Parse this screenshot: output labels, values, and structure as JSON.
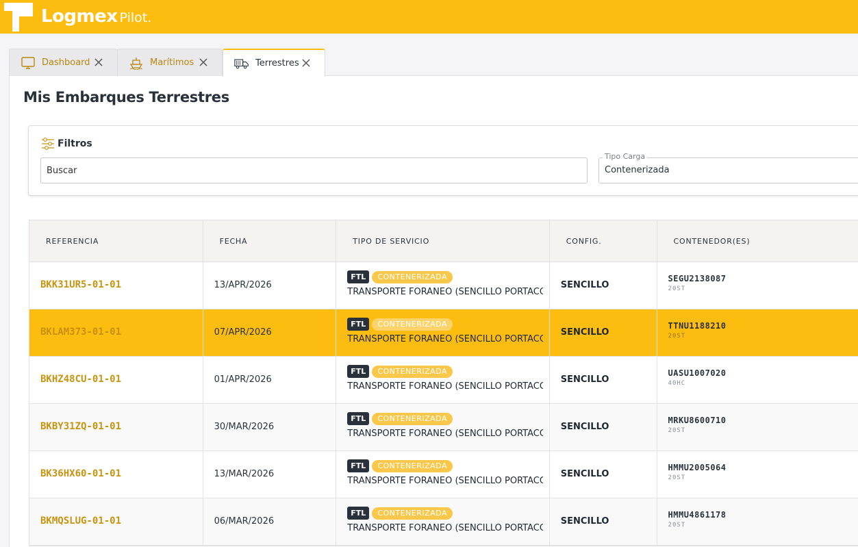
{
  "app": {
    "brand": "Logmex",
    "product": "Pilot.",
    "accent_color": "#fdbd10"
  },
  "tabs": [
    {
      "label": "Dashboard",
      "icon": "monitor-icon",
      "active": false
    },
    {
      "label": "Marítimos",
      "icon": "ship-icon",
      "active": false
    },
    {
      "label": "Terrestres",
      "icon": "truck-icon",
      "active": true
    }
  ],
  "page": {
    "title": "Mis Embarques Terrestres"
  },
  "filters": {
    "title": "Filtros",
    "search_placeholder": "Buscar",
    "tipo_carga_label": "Tipo Carga",
    "tipo_carga_value": "Contenerizada"
  },
  "table": {
    "columns": [
      "REFERENCIA",
      "FECHA",
      "TIPO DE SERVICIO",
      "CONFIG.",
      "CONTENEDOR(ES)"
    ],
    "rows": [
      {
        "ref": "BKK31UR5-01-01",
        "fecha": "13/APR/2026",
        "modo": "FTL",
        "tipo": "CONTENERIZADA",
        "servicio": "TRANSPORTE FORÁNEO (SENCILLO PORTACONTI",
        "config": "SENCILLO",
        "contenedor": "SEGU2138087",
        "tamano": "20ST"
      },
      {
        "ref": "BKLAM373-01-01",
        "fecha": "07/APR/2026",
        "modo": "FTL",
        "tipo": "CONTENERIZADA",
        "servicio": "TRANSPORTE FORÁNEO (SENCILLO PORTACONTI",
        "config": "SENCILLO",
        "contenedor": "TTNU1188210",
        "tamano": "20ST"
      },
      {
        "ref": "BKHZ48CU-01-01",
        "fecha": "01/APR/2026",
        "modo": "FTL",
        "tipo": "CONTENERIZADA",
        "servicio": "TRANSPORTE FORÁNEO (SENCILLO PORTACONTI",
        "config": "SENCILLO",
        "contenedor": "UASU1007020",
        "tamano": "40HC"
      },
      {
        "ref": "BKBY31ZQ-01-01",
        "fecha": "30/MAR/2026",
        "modo": "FTL",
        "tipo": "CONTENERIZADA",
        "servicio": "TRANSPORTE FORÁNEO (SENCILLO PORTACONTI",
        "config": "SENCILLO",
        "contenedor": "MRKU8600710",
        "tamano": "20ST"
      },
      {
        "ref": "BK36HX60-01-01",
        "fecha": "13/MAR/2026",
        "modo": "FTL",
        "tipo": "CONTENERIZADA",
        "servicio": "TRANSPORTE FORÁNEO (SENCILLO PORTACONTI",
        "config": "SENCILLO",
        "contenedor": "HMMU2005064",
        "tamano": "20ST"
      },
      {
        "ref": "BKMQSLUG-01-01",
        "fecha": "06/MAR/2026",
        "modo": "FTL",
        "tipo": "CONTENERIZADA",
        "servicio": "TRANSPORTE FORÁNEO (SENCILLO PORTACONTI",
        "config": "SENCILLO",
        "contenedor": "HMMU4861178",
        "tamano": "20ST"
      }
    ]
  }
}
